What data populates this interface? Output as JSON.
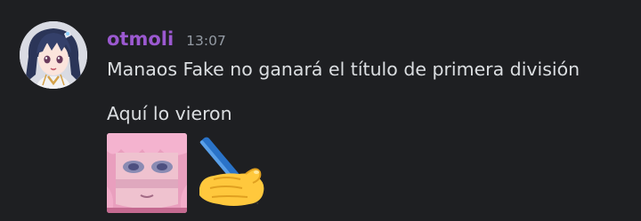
{
  "message": {
    "username": "otmoli",
    "timestamp": "13:07",
    "lines": [
      "Manaos Fake no ganará el título de primera división",
      "Aquí lo vieron"
    ],
    "avatar_icon": "anime-girl-avatar",
    "emojis": [
      "pink-hair-peeking-emoji",
      "writing-hand-emoji"
    ]
  },
  "colors": {
    "background": "#1e1f22",
    "username": "#9b59d0",
    "timestamp": "#949ba4",
    "text": "#dbdee1"
  }
}
